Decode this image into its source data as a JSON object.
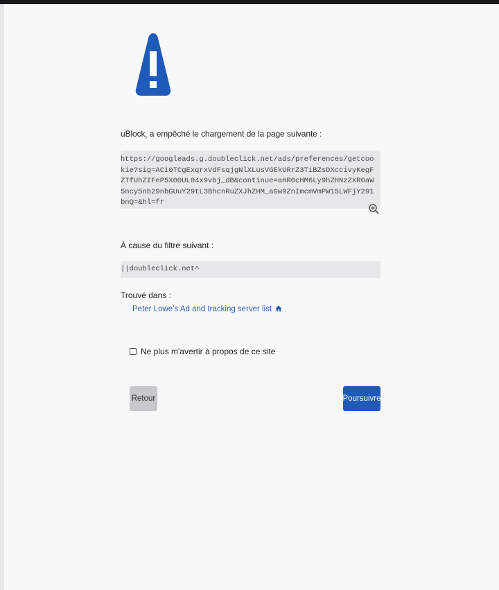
{
  "intro": {
    "prefix": "uBlock",
    "sup": "₀",
    "suffix": " a empêché le chargement de la page suivante :"
  },
  "blocked_url": "https://googleads.g.doubleclick.net/ads/preferences/getcookie?sig=ACi0TCgExqrxVdFsqjgNlXLusVGEkURrZ3TiBZsDXccivyKegFZTfUhZIFeP5X00UL04x9vbj_dB&continue=aHR0cHM6Ly9hZHNzZXR0aW5ncy5nb29nbGUuY29tL3BhcnRuZXJhZHM_aGw9ZnImcmVmPW15LWFjY291bnQ=&hl=fr",
  "because_label": "À cause du filtre suivant :",
  "filter": "||doubleclick.net^",
  "found_in_label": "Trouvé dans :",
  "filter_list": "Peter Lowe’s Ad and tracking server list",
  "dont_warn_label": "Ne plus m'avertir à propos de ce site",
  "buttons": {
    "back": "Retour",
    "proceed": "Poursuivre"
  },
  "colors": {
    "accent": "#1f5ab8",
    "link": "#2a5db0",
    "warning_icon": "#1f5ab8"
  },
  "icons": [
    "warning-icon",
    "zoom-in-icon",
    "home-icon"
  ]
}
